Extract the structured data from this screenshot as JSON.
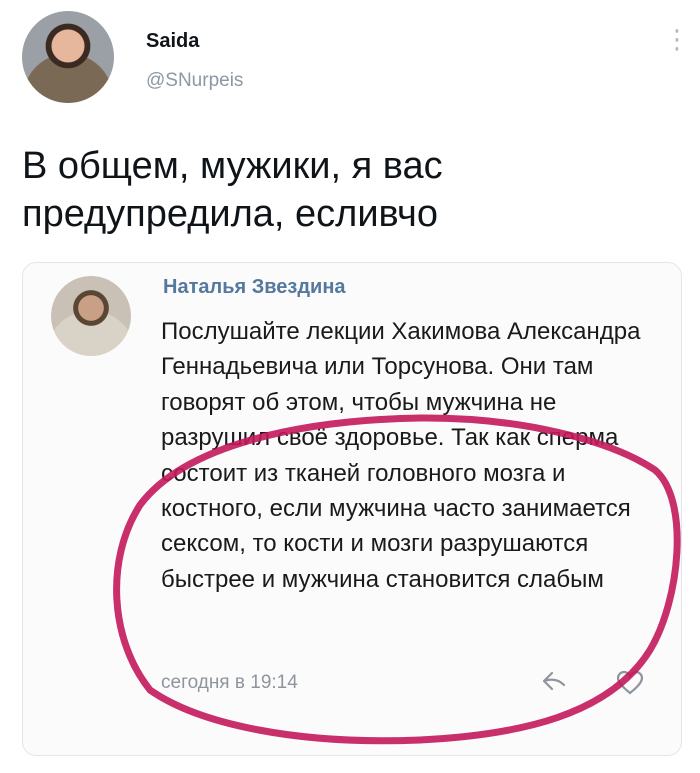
{
  "tweet": {
    "author_name": "Saida",
    "author_handle": "@SNurpeis",
    "text": "В общем, мужики, я вас предупредила, есливчо"
  },
  "quoted_comment": {
    "author": "Наталья Звездина",
    "text": "Послушайте лекции Хакимова Александра Геннадьевича или Торсунова. Они там говорят об этом, чтобы мужчина не разрушил своё здоровье. Так как сперма состоит из тканей головного мозга и костного, если мужчина часто занимается сексом, то кости и мозги разрушаются быстрее и мужчина становится слабым",
    "timestamp": "сегодня в 19:14"
  },
  "icons": {
    "more": "more-vertical-icon",
    "share": "share-arrow-icon",
    "like": "heart-icon"
  },
  "colors": {
    "author_link": "#55789e",
    "handle": "#8b98a5",
    "highlight_circle": "#c2185b"
  }
}
